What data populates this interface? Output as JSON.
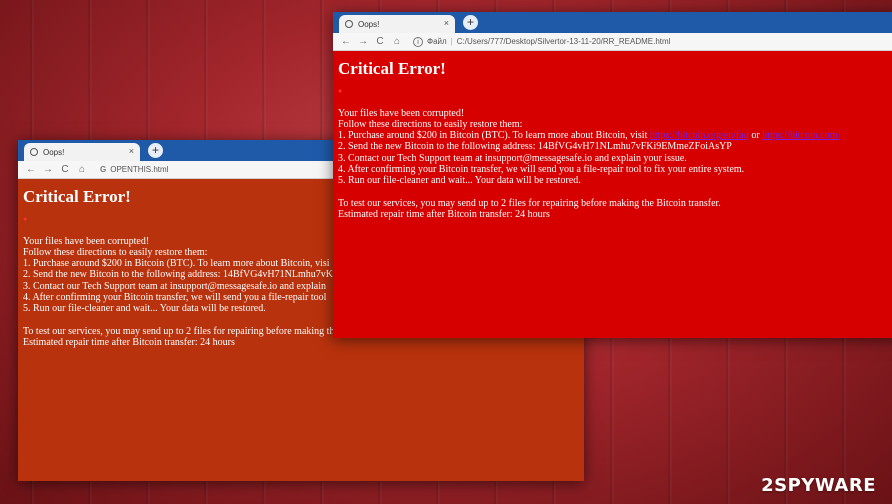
{
  "back_window": {
    "tab_title": "Oops!",
    "close": "×",
    "new_tab": "+",
    "nav": {
      "back": "←",
      "forward": "→",
      "reload": "C",
      "home": "⌂"
    },
    "address_icon": "G",
    "url": "OPENTHIS.html",
    "heading": "Critical Error!",
    "dot": "●",
    "lines": [
      "Your files have been corrupted!",
      "Follow these directions to easily restore them:",
      "1. Purchase around $200 in Bitcoin (BTC). To learn more about Bitcoin, visi",
      "2. Send the new Bitcoin to the following address: 14BfVG4vH71NLmhu7vK",
      "3. Contact our Tech Support team at insupport@messagesafe.io and explain",
      "4. After confirming your Bitcoin transfer, we will send you a file-repair tool",
      "5. Run our file-cleaner and wait... Your data will be restored."
    ],
    "footer_lines": [
      "To test our services, you may send up to 2 files for repairing before making the Bitcoin transfer.",
      "Estimated repair time after Bitcoin transfer: 24 hours"
    ]
  },
  "front_window": {
    "tab_title": "Oops!",
    "close": "×",
    "new_tab": "+",
    "nav": {
      "back": "←",
      "forward": "→",
      "reload": "C",
      "home": "⌂"
    },
    "address_icon": "i",
    "address_prefix": "Файл",
    "url": "C:/Users/777/Desktop/Silvertor-13-11-20/RR_README.html",
    "heading": "Critical Error!",
    "dot": "●",
    "lines": [
      "Your files have been corrupted!",
      "Follow these directions to easily restore them:"
    ],
    "step1_prefix": "1. Purchase around $200 in Bitcoin (BTC). To learn more about Bitcoin, visit ",
    "step1_link1": "https://bitcoin.org/en/faq",
    "step1_or": " or ",
    "step1_link2": "https://bitcoin.com/",
    "steps": [
      "2. Send the new Bitcoin to the following address: 14BfVG4vH71NLmhu7vFKi9EMmeZFoiAsYP",
      "3. Contact our Tech Support team at insupport@messagesafe.io and explain your issue.",
      "4. After confirming your Bitcoin transfer, we will send you a file-repair tool to fix your entire system.",
      "5. Run our file-cleaner and wait... Your data will be restored."
    ],
    "footer_lines": [
      "To test our services, you may send up to 2 files for repairing before making the Bitcoin transfer.",
      "Estimated repair time after Bitcoin transfer: 24 hours"
    ]
  },
  "watermark": "2SPYWARE"
}
